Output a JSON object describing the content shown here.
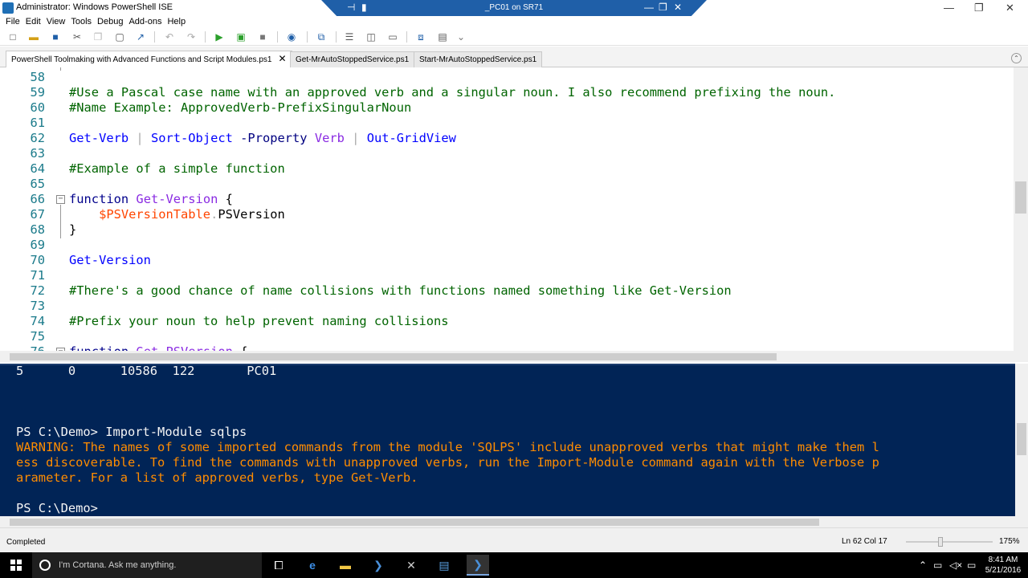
{
  "window": {
    "title": "Administrator: Windows PowerShell ISE",
    "rdp_title": "_PC01 on SR71",
    "controls": [
      "—",
      "❐",
      "✕"
    ]
  },
  "menu": [
    "File",
    "Edit",
    "View",
    "Tools",
    "Debug",
    "Add-ons",
    "Help"
  ],
  "tabs": [
    {
      "label": "PowerShell Toolmaking with Advanced Functions and Script Modules.ps1",
      "close": "✕",
      "active": true
    },
    {
      "label": "Get-MrAutoStoppedService.ps1",
      "active": false
    },
    {
      "label": "Start-MrAutoStoppedService.ps1",
      "active": false
    }
  ],
  "editor": {
    "lines": [
      {
        "n": "58",
        "tokens": []
      },
      {
        "n": "59",
        "tokens": [
          {
            "t": "#Use a Pascal case name with an approved verb and a singular noun. I also recommend prefixing the noun.",
            "c": "c-comment"
          }
        ]
      },
      {
        "n": "60",
        "tokens": [
          {
            "t": "#Name Example: ApprovedVerb-PrefixSingularNoun",
            "c": "c-comment"
          }
        ]
      },
      {
        "n": "61",
        "tokens": []
      },
      {
        "n": "62",
        "tokens": [
          {
            "t": "Get-Verb",
            "c": "c-cmd"
          },
          {
            "t": " | ",
            "c": "c-op"
          },
          {
            "t": "Sort-Object",
            "c": "c-cmd"
          },
          {
            "t": " -Property ",
            "c": "c-param"
          },
          {
            "t": "Verb",
            "c": "c-arg"
          },
          {
            "t": " | ",
            "c": "c-op"
          },
          {
            "t": "Out-GridView",
            "c": "c-cmd"
          }
        ]
      },
      {
        "n": "63",
        "tokens": []
      },
      {
        "n": "64",
        "tokens": [
          {
            "t": "#Example of a simple function",
            "c": "c-comment"
          }
        ]
      },
      {
        "n": "65",
        "tokens": []
      },
      {
        "n": "66",
        "tokens": [
          {
            "t": "function",
            "c": "c-kw"
          },
          {
            "t": " ",
            "c": "c-plain"
          },
          {
            "t": "Get-Version",
            "c": "c-fn"
          },
          {
            "t": " {",
            "c": "c-plain"
          }
        ]
      },
      {
        "n": "67",
        "tokens": [
          {
            "t": "    ",
            "c": "c-plain"
          },
          {
            "t": "$PSVersionTable",
            "c": "c-var"
          },
          {
            "t": ".",
            "c": "c-op"
          },
          {
            "t": "PSVersion",
            "c": "c-plain"
          }
        ]
      },
      {
        "n": "68",
        "tokens": [
          {
            "t": "}",
            "c": "c-plain"
          }
        ]
      },
      {
        "n": "69",
        "tokens": []
      },
      {
        "n": "70",
        "tokens": [
          {
            "t": "Get-Version",
            "c": "c-cmd"
          }
        ]
      },
      {
        "n": "71",
        "tokens": []
      },
      {
        "n": "72",
        "tokens": [
          {
            "t": "#There's a good chance of name collisions with functions named something like Get-Version",
            "c": "c-comment"
          }
        ]
      },
      {
        "n": "73",
        "tokens": []
      },
      {
        "n": "74",
        "tokens": [
          {
            "t": "#Prefix your noun to help prevent naming collisions",
            "c": "c-comment"
          }
        ]
      },
      {
        "n": "75",
        "tokens": []
      },
      {
        "n": "76",
        "tokens": [
          {
            "t": "function",
            "c": "c-kw"
          },
          {
            "t": " ",
            "c": "c-plain"
          },
          {
            "t": "Get-PSVersion",
            "c": "c-fn"
          },
          {
            "t": " {",
            "c": "c-plain"
          }
        ]
      }
    ]
  },
  "console": {
    "lines": [
      {
        "t": "5      0      10586  122       PC01",
        "warn": false
      },
      {
        "t": "",
        "warn": false
      },
      {
        "t": "",
        "warn": false
      },
      {
        "t": "",
        "warn": false
      },
      {
        "t": "PS C:\\Demo> Import-Module sqlps",
        "warn": false
      },
      {
        "t": "WARNING: The names of some imported commands from the module 'SQLPS' include unapproved verbs that might make them l",
        "warn": true
      },
      {
        "t": "ess discoverable. To find the commands with unapproved verbs, run the Import-Module command again with the Verbose p",
        "warn": true
      },
      {
        "t": "arameter. For a list of approved verbs, type Get-Verb.",
        "warn": true
      },
      {
        "t": "",
        "warn": false
      },
      {
        "t": "PS C:\\Demo>",
        "warn": false
      }
    ]
  },
  "status": {
    "text": "Completed",
    "position": "Ln 62  Col 17",
    "zoom": "175%"
  },
  "taskbar": {
    "search_placeholder": "I'm Cortana. Ask me anything.",
    "time": "8:41 AM",
    "date": "5/21/2016"
  }
}
